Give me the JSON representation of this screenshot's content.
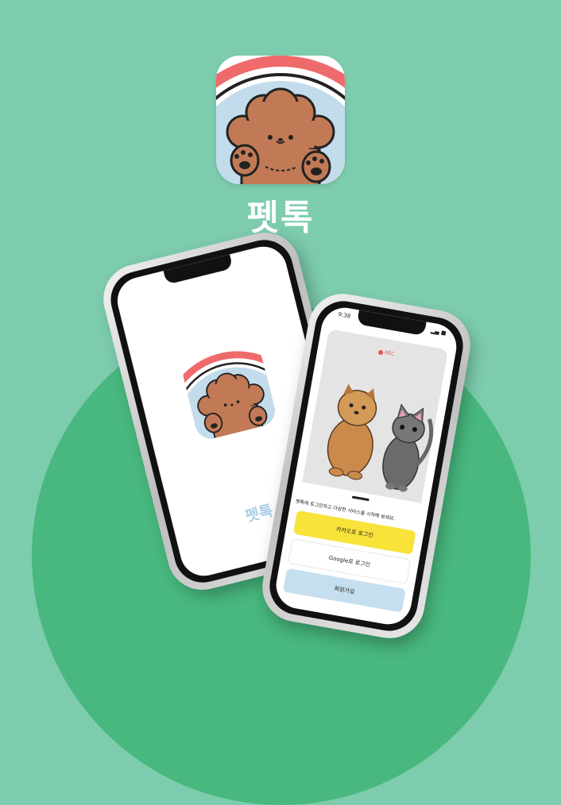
{
  "app": {
    "name": "펫톡"
  },
  "left_phone": {
    "splash_title": "펫톡"
  },
  "right_phone": {
    "status_time": "9:38",
    "status_icons": "▂▄ ■",
    "rec_label": "REC",
    "login_prompt": "펫톡에 로그인하고 다양한 서비스를 시작해 보세요.",
    "kakao_button": "카카오로 로그인",
    "google_button": "Google로 로그인",
    "signup_button": "회원가입"
  },
  "colors": {
    "background": "#7dccad",
    "circle": "#48b87e",
    "icon_red": "#ef6b6b",
    "icon_blue": "#c2dcec",
    "dog_brown": "#c17a55",
    "kakao_yellow": "#f7e33a",
    "signup_blue": "#c6dff0"
  }
}
